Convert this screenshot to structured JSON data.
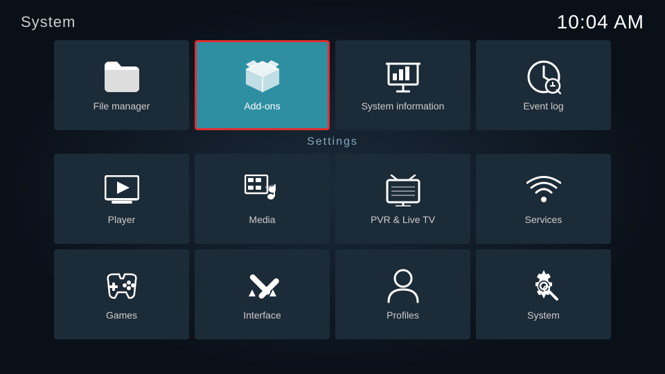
{
  "header": {
    "title": "System",
    "time": "10:04 AM"
  },
  "top_row": [
    {
      "id": "file-manager",
      "label": "File manager",
      "active": false
    },
    {
      "id": "add-ons",
      "label": "Add-ons",
      "active": true
    },
    {
      "id": "system-information",
      "label": "System information",
      "active": false
    },
    {
      "id": "event-log",
      "label": "Event log",
      "active": false
    }
  ],
  "settings_label": "Settings",
  "settings_row1": [
    {
      "id": "player",
      "label": "Player"
    },
    {
      "id": "media",
      "label": "Media"
    },
    {
      "id": "pvr-live-tv",
      "label": "PVR & Live TV"
    },
    {
      "id": "services",
      "label": "Services"
    }
  ],
  "settings_row2": [
    {
      "id": "games",
      "label": "Games"
    },
    {
      "id": "interface",
      "label": "Interface"
    },
    {
      "id": "profiles",
      "label": "Profiles"
    },
    {
      "id": "system",
      "label": "System"
    }
  ]
}
